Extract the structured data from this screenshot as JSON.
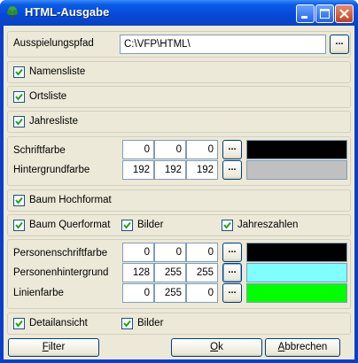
{
  "window": {
    "title": "HTML-Ausgabe"
  },
  "path": {
    "label": "Ausspielungspfad",
    "value": "C:\\VFP\\HTML\\",
    "browse": "..."
  },
  "options": [
    {
      "label": "Namensliste",
      "checked": true
    },
    {
      "label": "Ortsliste",
      "checked": true
    },
    {
      "label": "Jahresliste",
      "checked": true
    }
  ],
  "colors1": {
    "text": {
      "label": "Schriftfarbe",
      "r": "0",
      "g": "0",
      "b": "0",
      "browse": "...",
      "swatch": "#000000"
    },
    "background": {
      "label": "Hintergrundfarbe",
      "r": "192",
      "g": "192",
      "b": "192",
      "browse": "...",
      "swatch": "#c0c0c0"
    }
  },
  "tree_portrait": {
    "label": "Baum Hochformat",
    "checked": true
  },
  "tree_landscape": {
    "label": "Baum Querformat",
    "checked": true,
    "images_label": "Bilder",
    "images_checked": true,
    "years_label": "Jahreszahlen",
    "years_checked": true
  },
  "colors2": {
    "person_text": {
      "label": "Personenschriftfarbe",
      "r": "0",
      "g": "0",
      "b": "0",
      "browse": "...",
      "swatch": "#000000"
    },
    "person_background": {
      "label": "Personenhintergrund",
      "r": "128",
      "g": "255",
      "b": "255",
      "browse": "...",
      "swatch": "#80ffff"
    },
    "line": {
      "label": "Linienfarbe",
      "r": "0",
      "g": "255",
      "b": "0",
      "browse": "...",
      "swatch": "#00ff00"
    }
  },
  "detail": {
    "label": "Detailansicht",
    "checked": true,
    "images_label": "Bilder",
    "images_checked": true
  },
  "buttons": {
    "filter_first": "F",
    "filter_rest": "ilter",
    "ok_first": "O",
    "ok_rest": "k",
    "cancel_first": "A",
    "cancel_rest": "bbrechen"
  },
  "accent": "#0a5be6"
}
